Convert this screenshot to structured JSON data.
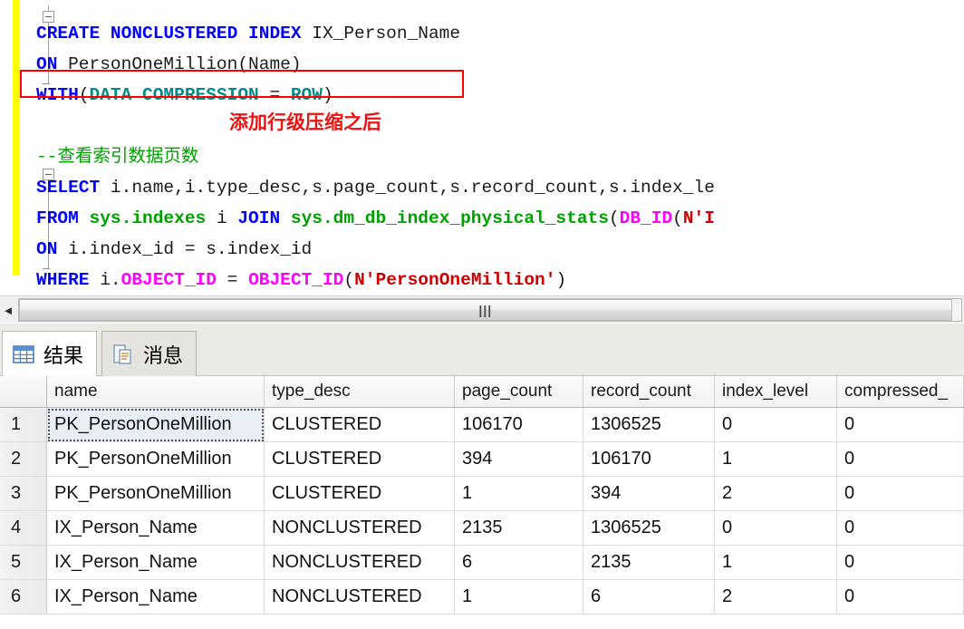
{
  "editor": {
    "change_bar_color": "#ffff00",
    "highlight_box_color": "#ff0000",
    "annotation": {
      "text": "添加行级压缩之后",
      "color": "#ee1111"
    },
    "lines": [
      {
        "id": "line1",
        "segments": [
          {
            "text": "CREATE NONCLUSTERED INDEX ",
            "cls": "kw"
          },
          {
            "text": "IX_Person_Name",
            "cls": "plain"
          }
        ]
      },
      {
        "id": "line2",
        "segments": [
          {
            "text": "ON ",
            "cls": "kw"
          },
          {
            "text": "PersonOneMillion",
            "cls": "plain"
          },
          {
            "text": "(Name)",
            "cls": "plain"
          }
        ]
      },
      {
        "id": "line3",
        "segments": [
          {
            "text": "WITH",
            "cls": "kw"
          },
          {
            "text": "(",
            "cls": "plain"
          },
          {
            "text": "DATA COMPRESSION",
            "cls": "teal"
          },
          {
            "text": " = ",
            "cls": "plain"
          },
          {
            "text": "ROW",
            "cls": "teal"
          },
          {
            "text": ")",
            "cls": "plain"
          }
        ]
      },
      {
        "id": "line4",
        "segments": []
      },
      {
        "id": "line5",
        "segments": [
          {
            "text": "--查看索引数据页数",
            "cls": "cmt-green"
          }
        ]
      },
      {
        "id": "line6",
        "segments": [
          {
            "text": "SELECT ",
            "cls": "kw"
          },
          {
            "text": "i.name,i.type_desc,s.page_count,s.record_count,s.index_le",
            "cls": "plain"
          }
        ]
      },
      {
        "id": "line7",
        "segments": [
          {
            "text": "FROM ",
            "cls": "kw"
          },
          {
            "text": "sys.indexes",
            "cls": "tbl"
          },
          {
            "text": " i ",
            "cls": "plain"
          },
          {
            "text": "JOIN ",
            "cls": "kw"
          },
          {
            "text": "sys.dm_db_index_physical_stats",
            "cls": "tbl"
          },
          {
            "text": "(",
            "cls": "plain"
          },
          {
            "text": "DB_ID",
            "cls": "fn"
          },
          {
            "text": "(",
            "cls": "plain"
          },
          {
            "text": "N'I",
            "cls": "str"
          }
        ]
      },
      {
        "id": "line8",
        "segments": [
          {
            "text": "ON ",
            "cls": "kw"
          },
          {
            "text": "i.index_id = s.index_id",
            "cls": "plain"
          }
        ]
      },
      {
        "id": "line9",
        "segments": [
          {
            "text": "WHERE ",
            "cls": "kw"
          },
          {
            "text": "i.",
            "cls": "plain"
          },
          {
            "text": "OBJECT_ID",
            "cls": "fn"
          },
          {
            "text": " = ",
            "cls": "plain"
          },
          {
            "text": "OBJECT_ID",
            "cls": "fn"
          },
          {
            "text": "(",
            "cls": "plain"
          },
          {
            "text": "N'PersonOneMillion'",
            "cls": "str"
          },
          {
            "text": ")",
            "cls": "plain"
          }
        ]
      }
    ]
  },
  "scrollbar": {
    "left_arrow_glyph": "◄",
    "grip_glyph": "|||"
  },
  "tabs": [
    {
      "label": "结果",
      "icon": "results-grid-icon",
      "active": true
    },
    {
      "label": "消息",
      "icon": "messages-document-icon",
      "active": false
    }
  ],
  "grid": {
    "columns": [
      {
        "key": "rownum",
        "label": "",
        "width_class": "w-num"
      },
      {
        "key": "name",
        "label": "name",
        "width_class": "w-name"
      },
      {
        "key": "type_desc",
        "label": "type_desc",
        "width_class": "w-type"
      },
      {
        "key": "page_count",
        "label": "page_count",
        "width_class": "w-page"
      },
      {
        "key": "record_count",
        "label": "record_count",
        "width_class": "w-rec"
      },
      {
        "key": "index_level",
        "label": "index_level",
        "width_class": "w-lvl"
      },
      {
        "key": "compressed",
        "label": "compressed_",
        "width_class": "w-comp"
      }
    ],
    "rows": [
      {
        "rownum": "1",
        "name": "PK_PersonOneMillion",
        "type_desc": "CLUSTERED",
        "page_count": "106170",
        "record_count": "1306525",
        "index_level": "0",
        "compressed": "0",
        "selected": true
      },
      {
        "rownum": "2",
        "name": "PK_PersonOneMillion",
        "type_desc": "CLUSTERED",
        "page_count": "394",
        "record_count": "106170",
        "index_level": "1",
        "compressed": "0",
        "selected": false
      },
      {
        "rownum": "3",
        "name": "PK_PersonOneMillion",
        "type_desc": "CLUSTERED",
        "page_count": "1",
        "record_count": "394",
        "index_level": "2",
        "compressed": "0",
        "selected": false
      },
      {
        "rownum": "4",
        "name": "IX_Person_Name",
        "type_desc": "NONCLUSTERED",
        "page_count": "2135",
        "record_count": "1306525",
        "index_level": "0",
        "compressed": "0",
        "selected": false
      },
      {
        "rownum": "5",
        "name": "IX_Person_Name",
        "type_desc": "NONCLUSTERED",
        "page_count": "6",
        "record_count": "2135",
        "index_level": "1",
        "compressed": "0",
        "selected": false
      },
      {
        "rownum": "6",
        "name": "IX_Person_Name",
        "type_desc": "NONCLUSTERED",
        "page_count": "1",
        "record_count": "6",
        "index_level": "2",
        "compressed": "0",
        "selected": false
      }
    ]
  }
}
